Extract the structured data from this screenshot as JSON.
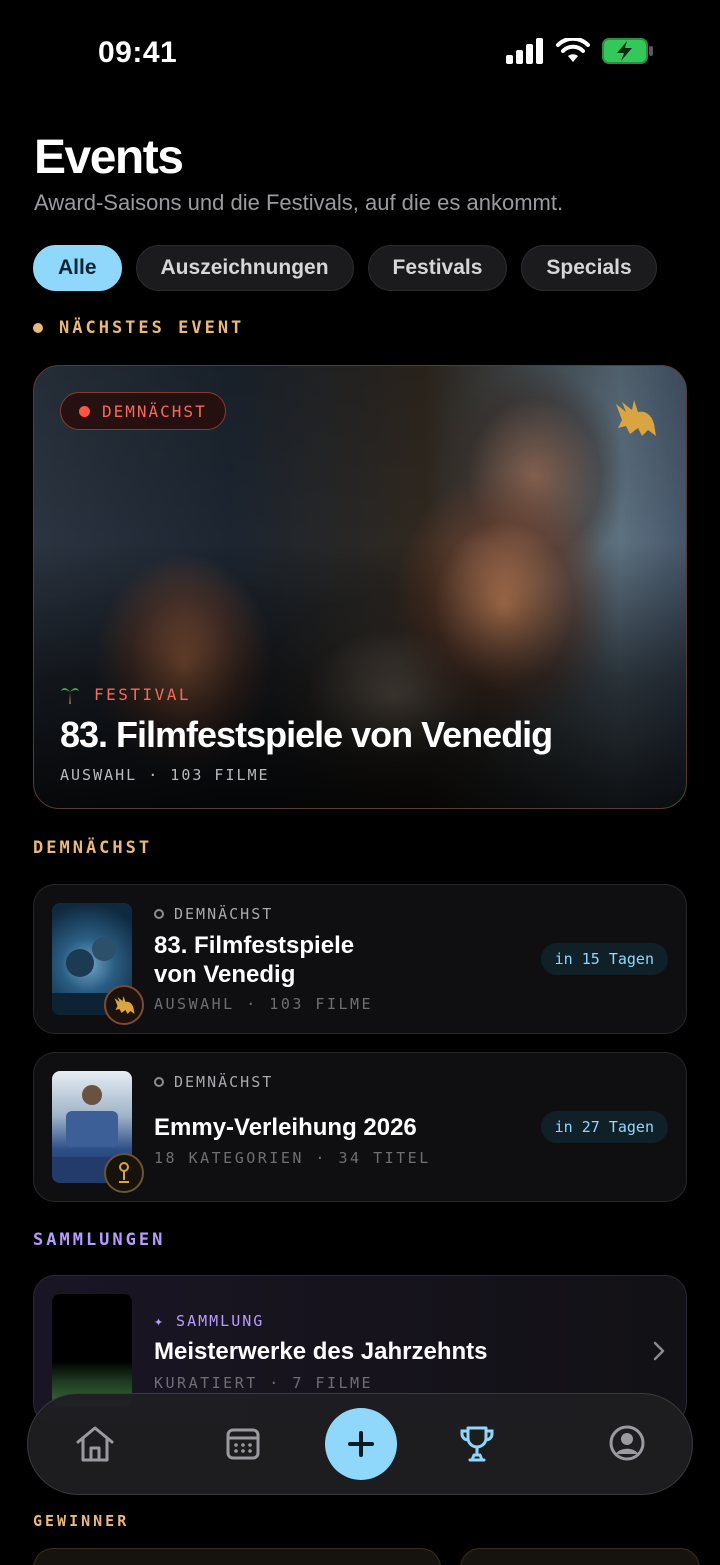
{
  "status_bar": {
    "time": "09:41"
  },
  "header": {
    "title": "Events",
    "subtitle": "Award-Saisons und die Festivals, auf die es ankommt."
  },
  "filters": [
    {
      "label": "Alle",
      "active": true
    },
    {
      "label": "Auszeichnungen",
      "active": false
    },
    {
      "label": "Festivals",
      "active": false
    },
    {
      "label": "Specials",
      "active": false
    }
  ],
  "next_event": {
    "section_label": "NÄCHSTES EVENT",
    "badge": "DEMNÄCHST",
    "category": "FESTIVAL",
    "title": "83. Filmfestspiele von Venedig",
    "meta": "AUSWAHL · 103 FILME"
  },
  "upcoming": {
    "section_label": "DEMNÄCHST",
    "items": [
      {
        "status": "DEMNÄCHST",
        "title_line1": "83. Filmfestspiele",
        "title_line2": "von Venedig",
        "meta": "AUSWAHL · 103 FILME",
        "countdown": "in 15 Tagen"
      },
      {
        "status": "DEMNÄCHST",
        "title": "Emmy-Verleihung 2026",
        "meta": "18 KATEGORIEN · 34 TITEL",
        "countdown": "in 27 Tagen"
      }
    ]
  },
  "collections": {
    "section_label": "SAMMLUNGEN",
    "items": [
      {
        "tag": "✦ SAMMLUNG",
        "title": "Meisterwerke des Jahrzehnts",
        "meta": "KURATIERT · 7 FILME"
      }
    ]
  },
  "winners": {
    "section_label": "GEWINNER"
  },
  "tab_bar": {
    "active": "trophy"
  },
  "colors": {
    "accent": "#8fd8fb",
    "gold": "#e9b87a",
    "red": "#ff5446",
    "purple": "#b79cff"
  }
}
